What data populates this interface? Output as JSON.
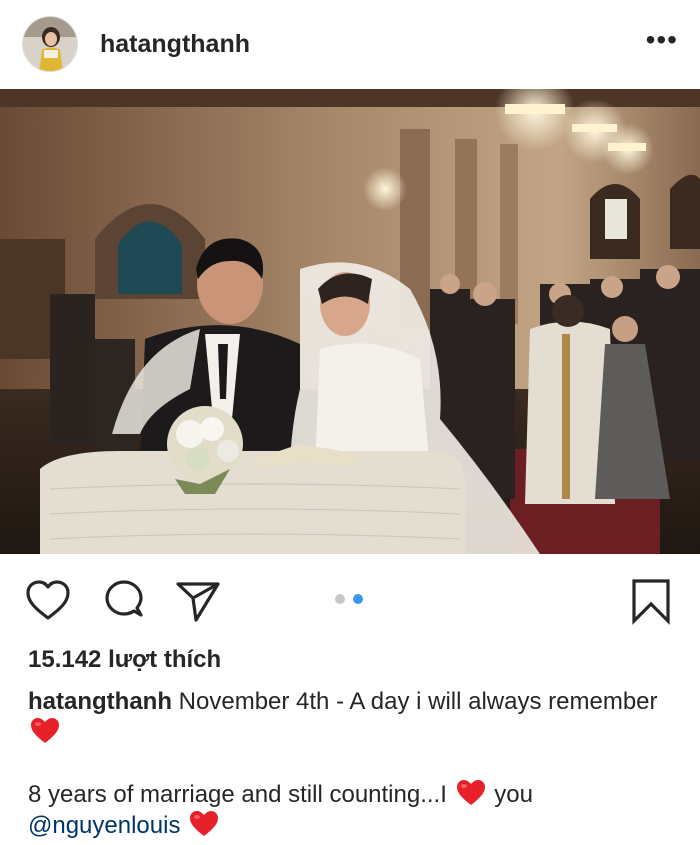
{
  "post": {
    "username": "hatangthanh",
    "more_label": "•••",
    "photo_alt": "wedding photo in church",
    "carousel": {
      "count": 2,
      "active_index": 1
    },
    "likes_text": "15.142 lượt thích",
    "caption": {
      "username": "hatangthanh",
      "line1_text": " November 4th - A day i will always remember ",
      "line2_text": "8 years of marriage and still counting...I ",
      "line2_after_heart": " you",
      "mention": "@nguyenlouis"
    }
  },
  "icons": {
    "like": "heart-outline-icon",
    "comment": "comment-bubble-icon",
    "share": "paper-plane-icon",
    "save": "bookmark-icon",
    "emoji_heart": "red-heart-emoji-icon"
  },
  "colors": {
    "text": "#262626",
    "carousel_active": "#3897f0",
    "carousel_inactive": "#c7c7c7",
    "heart_emoji": "#e8202a",
    "mention": "#003569"
  }
}
